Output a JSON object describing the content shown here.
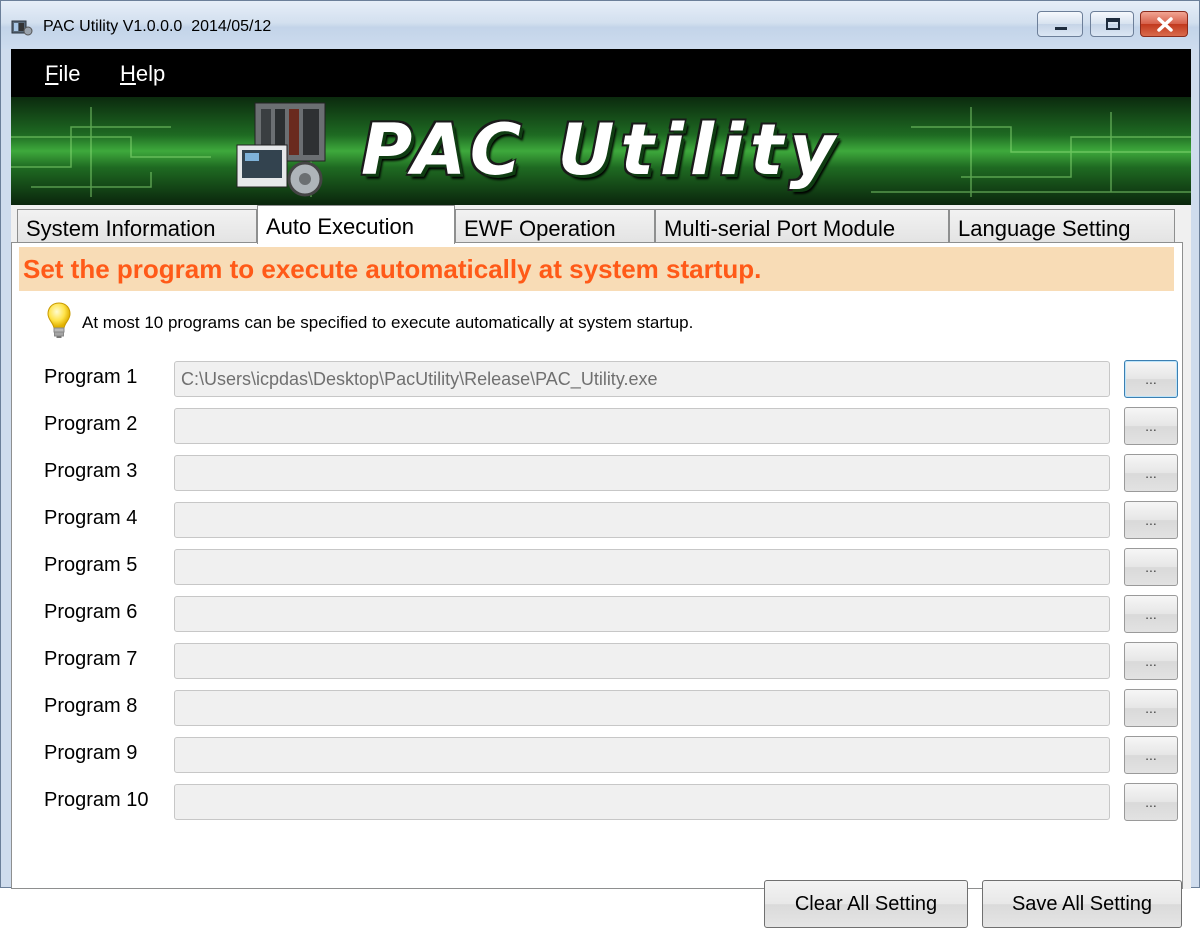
{
  "window": {
    "title": "PAC Utility V1.0.0.0  2014/05/12"
  },
  "menu": {
    "file": {
      "accel": "F",
      "rest": "ile"
    },
    "help": {
      "accel": "H",
      "rest": "elp"
    }
  },
  "banner": {
    "title": "PAC Utility"
  },
  "tabs": [
    {
      "label": "System Information"
    },
    {
      "label": "Auto Execution"
    },
    {
      "label": "EWF Operation"
    },
    {
      "label": "Multi-serial Port Module"
    },
    {
      "label": "Language Setting"
    }
  ],
  "auto_execution": {
    "heading": "Set the program to execute automatically at system startup.",
    "hint": "At most 10 programs can be specified to execute automatically at system startup.",
    "browse_label": "...",
    "programs": [
      {
        "label": "Program 1",
        "path": "C:\\Users\\icpdas\\Desktop\\PacUtility\\Release\\PAC_Utility.exe"
      },
      {
        "label": "Program 2",
        "path": ""
      },
      {
        "label": "Program 3",
        "path": ""
      },
      {
        "label": "Program 4",
        "path": ""
      },
      {
        "label": "Program 5",
        "path": ""
      },
      {
        "label": "Program 6",
        "path": ""
      },
      {
        "label": "Program 7",
        "path": ""
      },
      {
        "label": "Program 8",
        "path": ""
      },
      {
        "label": "Program 9",
        "path": ""
      },
      {
        "label": "Program 10",
        "path": ""
      }
    ],
    "clear_button": "Clear All Setting",
    "save_button": "Save All Setting"
  },
  "colors": {
    "heading_text": "#ff5a18",
    "heading_bg": "#f8dcb6",
    "banner_green": "#3ea93c"
  }
}
